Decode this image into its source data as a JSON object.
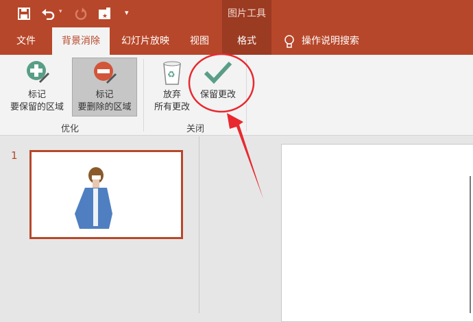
{
  "quick_access": {
    "save": "save-icon",
    "undo": "undo-icon",
    "redo": "redo-icon",
    "customize": "▾"
  },
  "context_group": "图片工具",
  "tabs": [
    {
      "label": "文件"
    },
    {
      "label": "背景消除",
      "active": true
    },
    {
      "label": "幻灯片放映"
    },
    {
      "label": "视图"
    },
    {
      "label": "格式"
    }
  ],
  "tell_me": "操作说明搜索",
  "ribbon": {
    "groups": [
      {
        "label": "优化",
        "buttons": [
          {
            "line1": "标记",
            "line2": "要保留的区域"
          },
          {
            "line1": "标记",
            "line2": "要删除的区域"
          }
        ]
      },
      {
        "label": "关闭",
        "buttons": [
          {
            "line1": "放弃",
            "line2": "所有更改"
          },
          {
            "line1": "保留更改"
          }
        ]
      }
    ]
  },
  "slides": [
    {
      "number": "1"
    }
  ],
  "colors": {
    "accent": "#b7472a",
    "annotation": "#e8292f"
  }
}
